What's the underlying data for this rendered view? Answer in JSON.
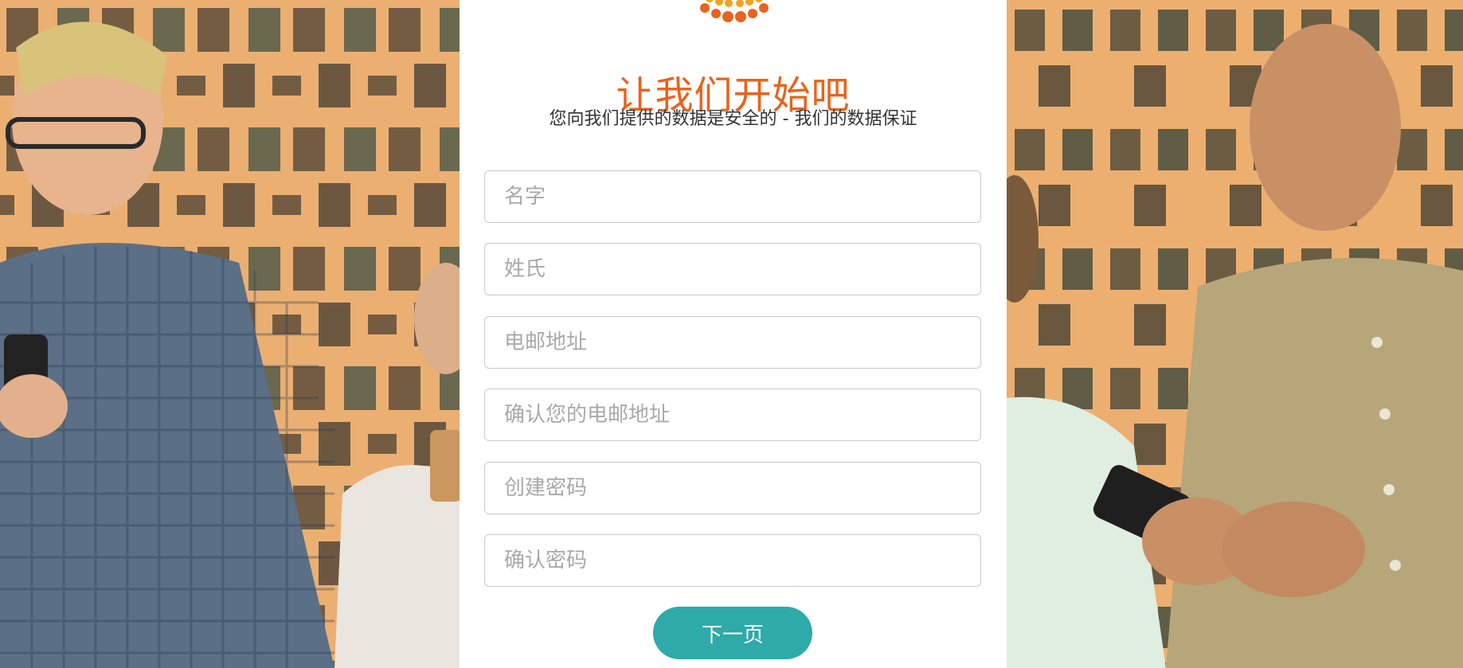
{
  "brand": {
    "accent_color": "#e8631c",
    "button_color": "#2eaaa9",
    "logo_icon": "orange-dot-burst-icon"
  },
  "header": {
    "title": "让我们开始吧",
    "subtitle": "您向我们提供的数据是安全的 - 我们的数据保证"
  },
  "form": {
    "first_name_placeholder": "名字",
    "last_name_placeholder": "姓氏",
    "email_placeholder": "电邮地址",
    "confirm_email_placeholder": "确认您的电邮地址",
    "password_placeholder": "创建密码",
    "confirm_password_placeholder": "确认密码",
    "next_label": "下一页"
  }
}
